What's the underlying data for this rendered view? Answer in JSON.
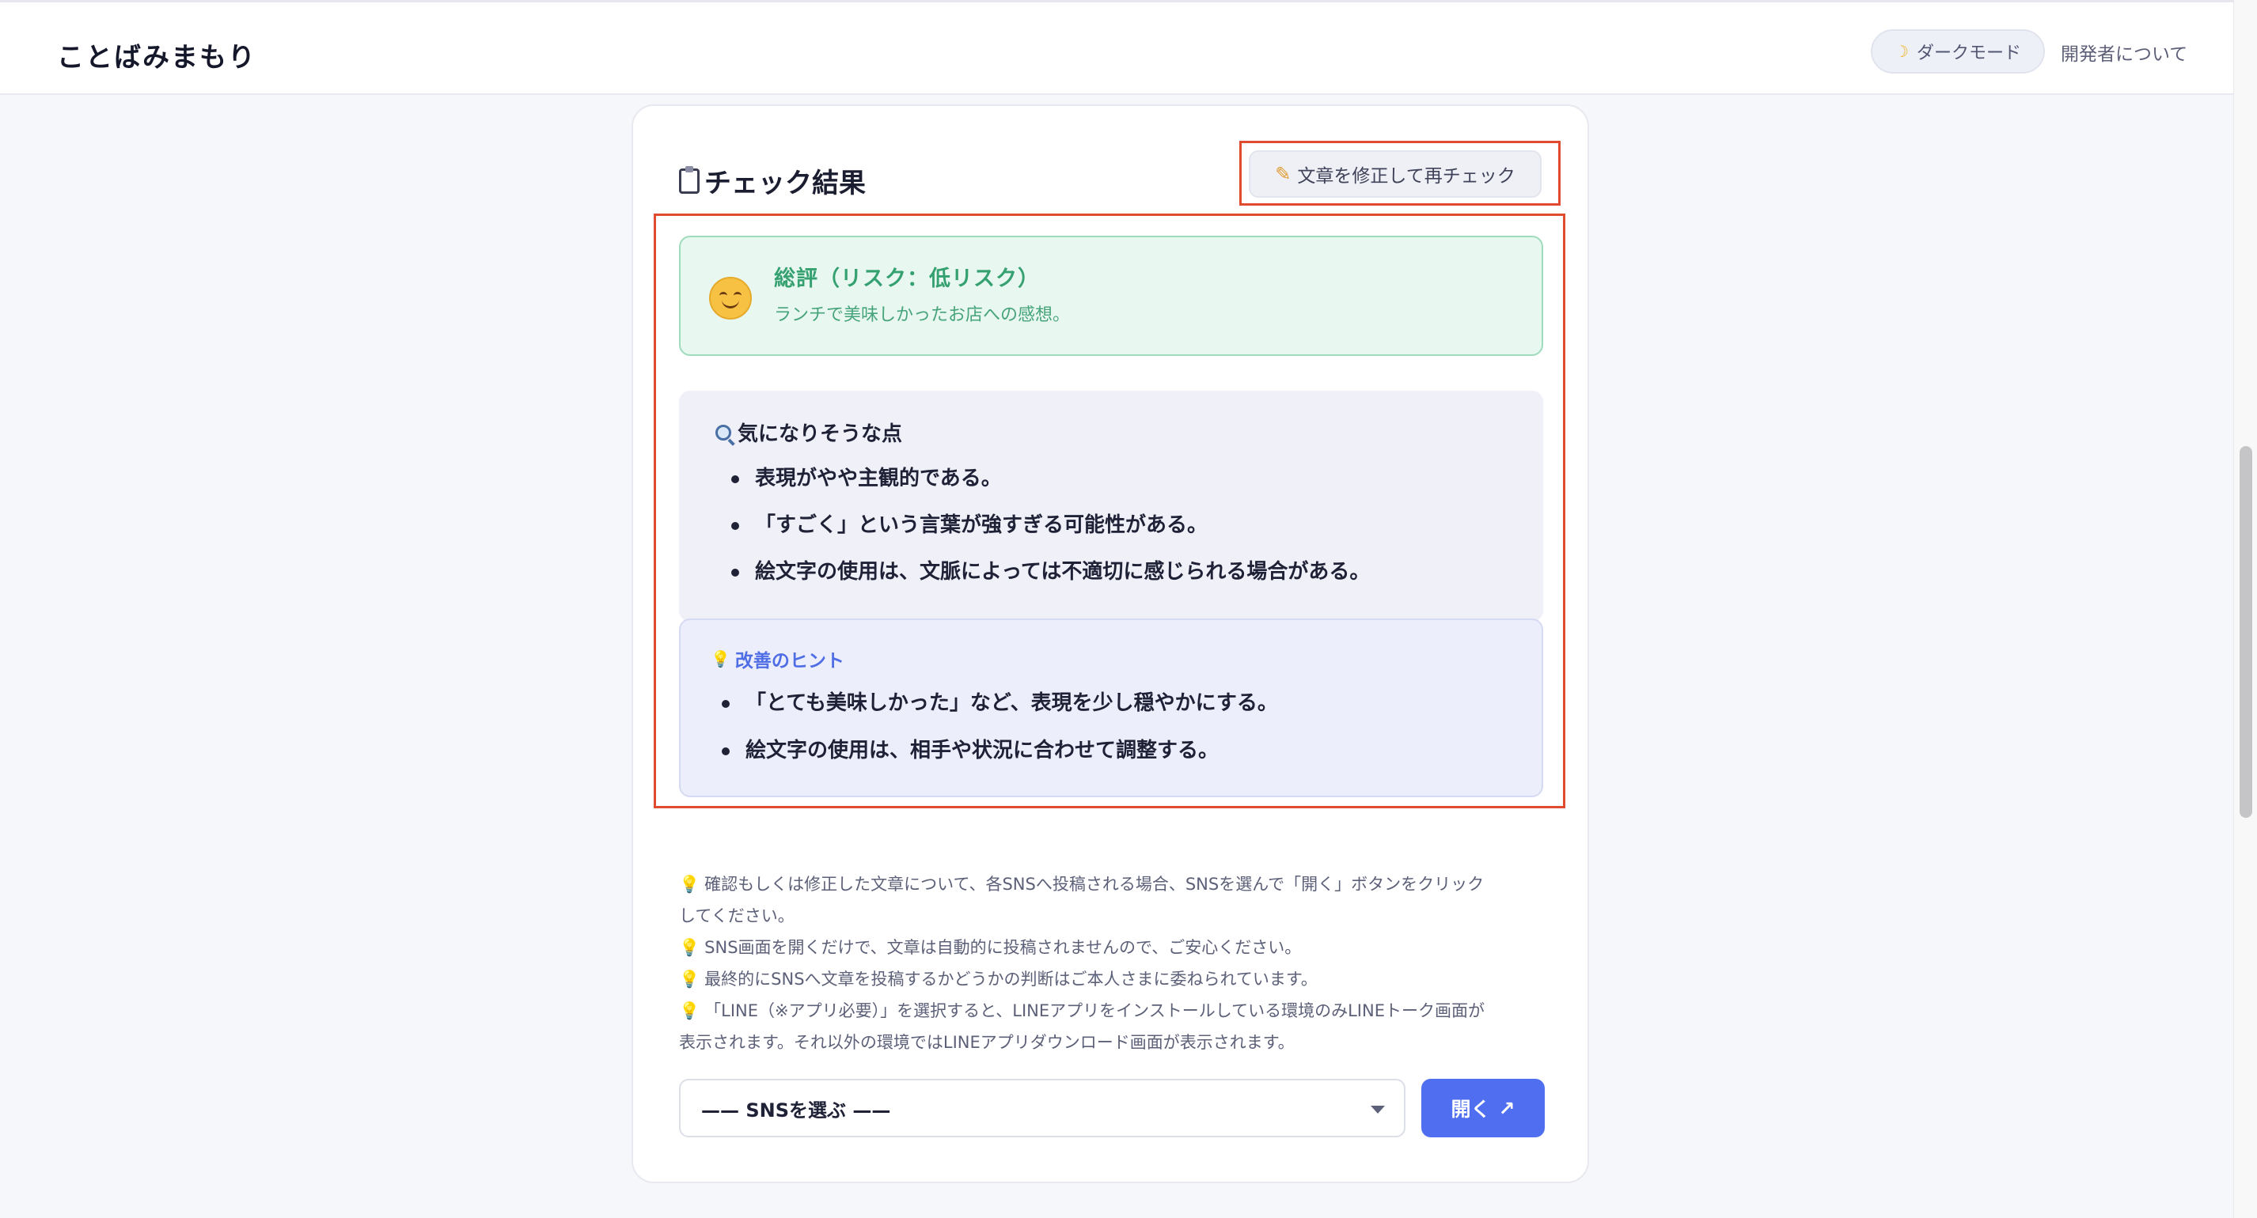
{
  "header": {
    "brand": "ことばみまもり",
    "dark_mode_icon": "moon-icon",
    "dark_mode_label": "ダークモード",
    "about_label": "開発者について"
  },
  "card": {
    "title": "チェック結果",
    "title_icon": "clipboard-icon",
    "recheck_icon": "pencil-icon",
    "recheck_label": "文章を修正して再チェック"
  },
  "summary": {
    "icon": "smiley-face-icon",
    "title": "総評（リスク：低リスク）",
    "text": "ランチで美味しかったお店への感想。"
  },
  "concerns": {
    "icon": "magnifier-icon",
    "title": "気になりそうな点",
    "items": [
      "表現がやや主観的である。",
      "「すごく」という言葉が強すぎる可能性がある。",
      "絵文字の使用は、文脈によっては不適切に感じられる場合がある。"
    ]
  },
  "hints": {
    "icon": "lightbulb-icon",
    "title": "改善のヒント",
    "items": [
      "「とても美味しかった」など、表現を少し穏やかにする。",
      "絵文字の使用は、相手や状況に合わせて調整する。"
    ]
  },
  "notes": {
    "icon": "lightbulb-icon",
    "lines": [
      "確認もしくは修正した文章について、各SNSへ投稿される場合、SNSを選んで「開く」ボタンをクリック",
      "してください。",
      "SNS画面を開くだけで、文章は自動的に投稿されませんので、ご安心ください。",
      "最終的にSNSへ文章を投稿するかどうかの判断はご本人さまに委ねられています。",
      "「LINE（※アプリ必要）」を選択すると、LINEアプリをインストールしている環境のみLINEトーク画面が",
      "表示されます。それ以外の環境ではLINEアプリダウンロード画面が表示されます。"
    ]
  },
  "sns": {
    "select_value": "—— SNSを選ぶ ——",
    "open_label": "開く",
    "open_icon": "external-link-arrow-icon"
  },
  "colors": {
    "accent": "#4f6ef0",
    "annotation_frame": "#e04b30",
    "low_risk_green": "#35a070",
    "hint_blue": "#4f6ee6"
  }
}
